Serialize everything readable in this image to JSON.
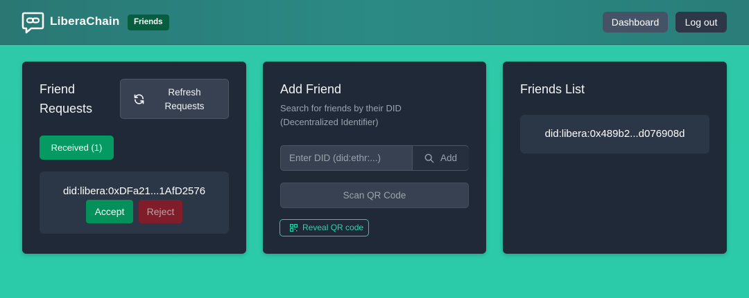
{
  "header": {
    "brand": "LiberaChain",
    "page_badge": "Friends",
    "logo_icon": "chat-link-icon",
    "dashboard_label": "Dashboard",
    "logout_label": "Log out"
  },
  "friend_requests": {
    "title": "Friend Requests",
    "refresh_label": "Refresh Requests",
    "refresh_icon": "refresh-icon",
    "tab_received": "Received (1)",
    "requests": [
      {
        "did": "did:libera:0xDFa21...1AfD2576",
        "accept_label": "Accept",
        "reject_label": "Reject"
      }
    ]
  },
  "add_friend": {
    "title": "Add Friend",
    "subtitle": "Search for friends by their DID (Decentralized Identifier)",
    "input_placeholder": "Enter DID (did:ethr:...)",
    "input_value": "",
    "add_label": "Add",
    "search_icon": "search-icon",
    "scan_label": "Scan QR Code",
    "reveal_label": "Reveal QR code",
    "qr_icon": "qr-code-icon"
  },
  "friends_list": {
    "title": "Friends List",
    "friends": [
      {
        "did": "did:libera:0x489b2...d076908d"
      }
    ]
  },
  "colors": {
    "page_bg": "#2ec9a8",
    "header_bg": "#2a7d79",
    "card_bg": "#1f2937",
    "accent_green": "#059a62",
    "reject_red": "#7f1d2a",
    "teal_accent": "#2dd4b0"
  }
}
